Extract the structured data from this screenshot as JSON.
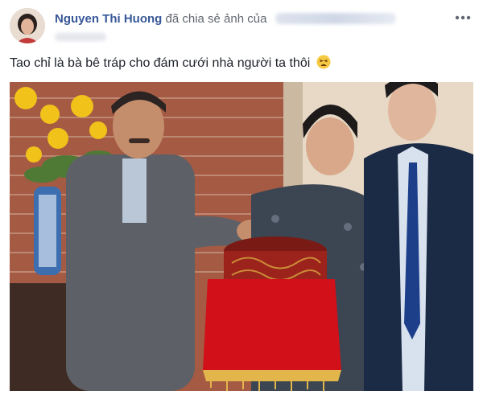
{
  "post": {
    "author": "Nguyen Thi Huong",
    "action_text": "đã chia sẻ ảnh của",
    "caption": "Tao chỉ là bà bê tráp cho đám cưới nhà người ta thôi",
    "caption_emoji_icon": "tired-face-emoji-icon",
    "more_icon": "more-options-icon"
  },
  "colors": {
    "author_link": "#385898",
    "text": "#1d2129",
    "muted": "#616770"
  }
}
